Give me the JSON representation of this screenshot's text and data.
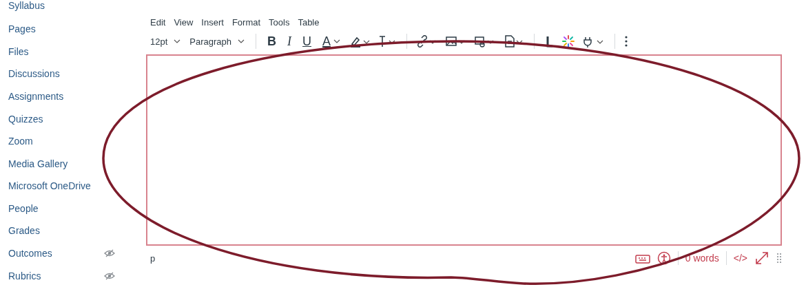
{
  "sidebar": {
    "items": [
      {
        "label": "Syllabus",
        "hidden": false
      },
      {
        "label": "Pages",
        "hidden": false
      },
      {
        "label": "Files",
        "hidden": false
      },
      {
        "label": "Discussions",
        "hidden": false
      },
      {
        "label": "Assignments",
        "hidden": false
      },
      {
        "label": "Quizzes",
        "hidden": false
      },
      {
        "label": "Zoom",
        "hidden": false
      },
      {
        "label": "Media Gallery",
        "hidden": false
      },
      {
        "label": "Microsoft OneDrive",
        "hidden": false
      },
      {
        "label": "People",
        "hidden": false
      },
      {
        "label": "Grades",
        "hidden": false
      },
      {
        "label": "Outcomes",
        "hidden": true
      },
      {
        "label": "Rubrics",
        "hidden": true
      }
    ]
  },
  "editor": {
    "menu": [
      "Edit",
      "View",
      "Insert",
      "Format",
      "Tools",
      "Table"
    ],
    "toolbar": {
      "font_size": "12pt",
      "block_format": "Paragraph",
      "format_buttons": [
        {
          "label": "B",
          "dropdown": false
        },
        {
          "label": "I",
          "dropdown": false
        },
        {
          "label": "U",
          "dropdown": false
        },
        {
          "label": "A",
          "dropdown": true
        }
      ]
    },
    "status": {
      "path": "p",
      "word_count": "0 words",
      "html_toggle": "</>"
    }
  }
}
